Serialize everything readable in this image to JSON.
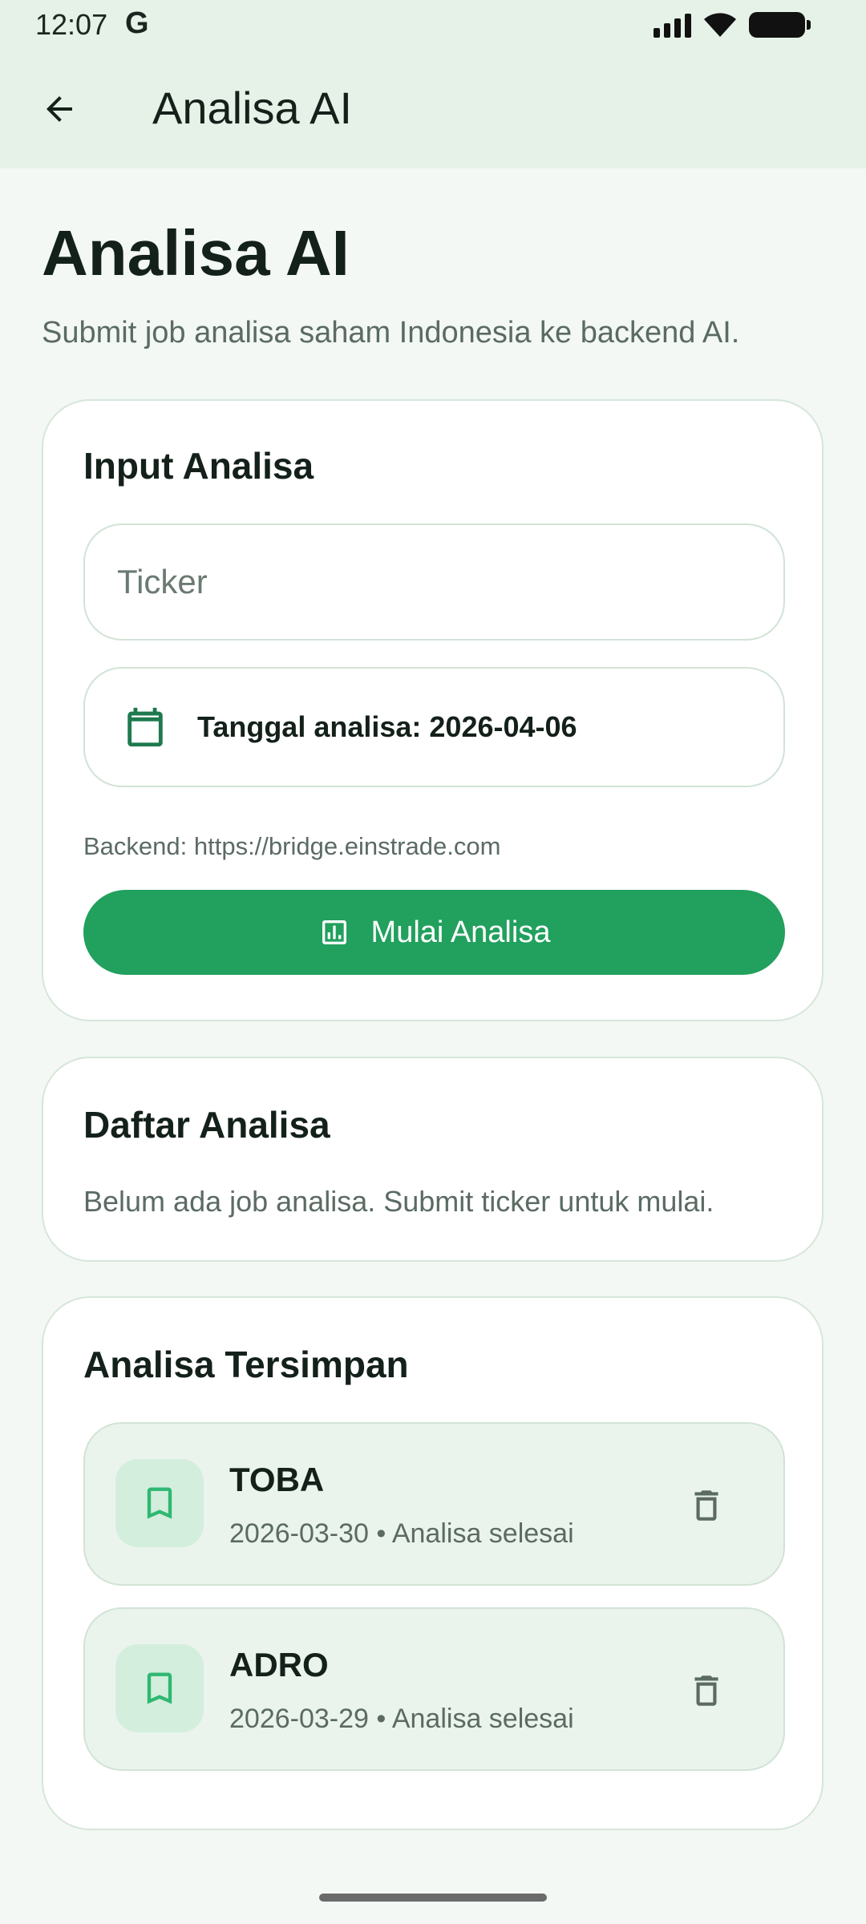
{
  "status_bar": {
    "time": "12:07",
    "g_logo": "G"
  },
  "app_bar": {
    "title": "Analisa AI"
  },
  "header": {
    "title": "Analisa AI",
    "subtitle": "Submit job analisa saham Indonesia ke backend AI."
  },
  "input_card": {
    "title": "Input Analisa",
    "ticker_placeholder": "Ticker",
    "ticker_value": "",
    "date_label": "Tanggal analisa: 2026-04-06",
    "backend": "Backend: https://bridge.einstrade.com",
    "submit_label": "Mulai Analisa"
  },
  "list_card": {
    "title": "Daftar Analisa",
    "empty_text": "Belum ada job analisa. Submit ticker untuk mulai."
  },
  "saved_card": {
    "title": "Analisa Tersimpan",
    "items": [
      {
        "ticker": "TOBA",
        "meta": "2026-03-30 • Analisa selesai"
      },
      {
        "ticker": "ADRO",
        "meta": "2026-03-29 • Analisa selesai"
      }
    ]
  },
  "icons": {
    "back": "arrow-back-icon",
    "calendar": "calendar-icon",
    "chart": "analytics-icon",
    "bookmark": "bookmark-icon",
    "delete": "trash-icon"
  },
  "colors": {
    "accent": "#21a05e",
    "app_bar_bg": "#e6f2e8",
    "page_bg": "#f3f8f4",
    "item_bg": "#eaf4ec",
    "icon_green": "#1e7a4e"
  }
}
